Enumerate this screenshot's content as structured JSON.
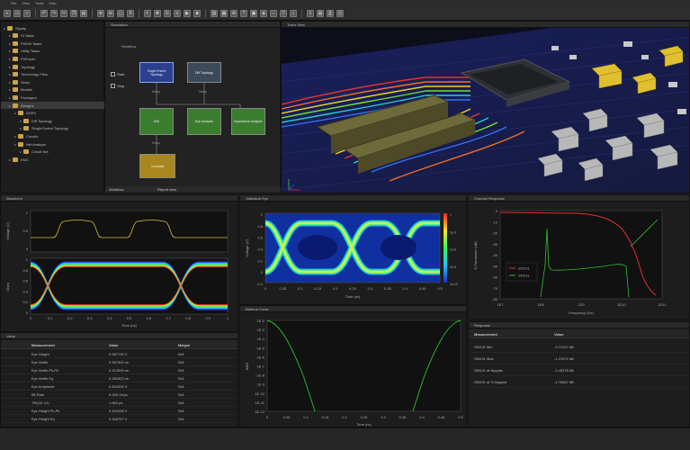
{
  "menu": [
    "File",
    "View",
    "Tools",
    "Help"
  ],
  "left_panel": {
    "title": "",
    "items": [
      {
        "label": "Signity",
        "depth": 0
      },
      {
        "label": "SI Tasks",
        "depth": 1
      },
      {
        "label": "PI/EMI Tasks",
        "depth": 1
      },
      {
        "label": "Utility Tasks",
        "depth": 1
      },
      {
        "label": "PI/Power",
        "depth": 1
      },
      {
        "label": "Topology",
        "depth": 1
      },
      {
        "label": "Technology Files",
        "depth": 1
      },
      {
        "label": "Setup",
        "depth": 1
      },
      {
        "label": "Models",
        "depth": 1
      },
      {
        "label": "Packages",
        "depth": 1
      },
      {
        "label": "Designs",
        "depth": 1,
        "selected": true
      },
      {
        "label": "DDR4",
        "depth": 2
      },
      {
        "label": "Diff Topology",
        "depth": 3
      },
      {
        "label": "Single Ended Topology",
        "depth": 3
      },
      {
        "label": "Circuits",
        "depth": 2
      },
      {
        "label": "Net Analysis",
        "depth": 2
      },
      {
        "label": "Circuit Net",
        "depth": 3
      },
      {
        "label": "EMC",
        "depth": 1
      }
    ]
  },
  "flow_panel": {
    "title": "Simulation",
    "subtitle": "Workflow",
    "start_label": "Start",
    "stop_label": "Stop",
    "nodes": [
      {
        "id": "single",
        "label": "Single Ended Topology",
        "color": "#2b3f8f"
      },
      {
        "id": "diff",
        "label": "Diff Topology",
        "color": "#3b4a5a"
      },
      {
        "id": "sim",
        "label": "SIM",
        "color": "#3a7d2e"
      },
      {
        "id": "eye",
        "label": "Eye Analysis",
        "color": "#3a7d2e"
      },
      {
        "id": "imp",
        "label": "Impedance Analysis",
        "color": "#3a7d2e"
      },
      {
        "id": "cross",
        "label": "Crosstalk",
        "color": "#a8871e"
      }
    ],
    "edge_labels": [
      "Setup",
      "Setup",
      "Setup"
    ],
    "footer_left": "Workflow",
    "footer_right": "Report view"
  },
  "view3d": {
    "title": "Trace View"
  },
  "waveform": {
    "title": "Waveform",
    "ylabel_top": "Voltage (V)",
    "ylabel_bottom": "Gbps",
    "xlabel": "Time (ns)",
    "xticks": [
      "0",
      "0.1",
      "0.2",
      "0.3",
      "0.4",
      "0.5",
      "0.6",
      "0.7",
      "0.8",
      "0.9",
      "1"
    ],
    "yticks_top": [
      "1",
      "0.5",
      "0"
    ],
    "yticks_bottom": [
      "1",
      "0.8",
      "0.6",
      "0.4",
      "0.2",
      "0"
    ]
  },
  "stat_eye": {
    "title": "Statistical Eye",
    "ylabel": "Voltage (V)",
    "xlabel": "Time (ns)",
    "xticks": [
      "0",
      "0.05",
      "0.1",
      "0.15",
      "0.2",
      "0.25",
      "0.3",
      "0.35",
      "0.4",
      "0.45",
      "0.5"
    ],
    "yticks": [
      "1",
      "0.8",
      "0.6",
      "0.4",
      "0.2",
      "0",
      "-0.2"
    ],
    "colorbar": [
      "1",
      "1e-3",
      "1e-6",
      "1e-9",
      "1e-12"
    ]
  },
  "channel": {
    "title": "Channel Response",
    "ylabel": "S-Parameter (dB)",
    "xlabel": "Frequency (Hz)",
    "xticks": [
      "1E7",
      "1E8",
      "1E9",
      "1E10",
      "1E11"
    ],
    "yticks": [
      "0",
      "-10",
      "-20",
      "-30",
      "-40",
      "-50",
      "-60",
      "-70",
      "-80"
    ],
    "legend": [
      {
        "name": "SDD21",
        "color": "#e03030"
      },
      {
        "name": "SDD11",
        "color": "#30c030"
      }
    ]
  },
  "bathtub": {
    "title": "Bathtub Curve",
    "ylabel": "BER",
    "xlabel": "Time (ns)",
    "xticks": [
      "0",
      "0.05",
      "0.1",
      "0.15",
      "0.2",
      "0.25",
      "0.3",
      "0.35",
      "0.4",
      "0.45",
      "0.5"
    ],
    "yticks": [
      "1E-2",
      "1E-3",
      "1E-4",
      "1E-5",
      "1E-6",
      "1E-7",
      "1E-8",
      "1E-9",
      "1E-10",
      "1E-11",
      "1E-12"
    ]
  },
  "eye_table": {
    "title": "Value",
    "columns": [
      "Measurement",
      "Value",
      "Margin"
    ],
    "rows": [
      [
        "Eye Height",
        "0.387735 V",
        "N/A"
      ],
      [
        "Eye Width",
        "0.357600 ns",
        "N/A"
      ],
      [
        "Eye Width Pk-Pk",
        "0.312500 ns",
        "N/A"
      ],
      [
        "Eye Width Eq",
        "0.280303 ns",
        "N/A"
      ],
      [
        "Eye Amplitude",
        "0.804292 V",
        "N/A"
      ],
      [
        "Bit Rate",
        "5.000 Gbps",
        "N/A"
      ],
      [
        "TIE(1E-12)",
        "1.663 ps",
        "N/A"
      ],
      [
        "Eye Height Pk-Pk",
        "0.424298 V",
        "N/A"
      ],
      [
        "Eye Height Eq",
        "0.348707 V",
        "N/A"
      ]
    ]
  },
  "resp_table": {
    "title": "Response",
    "columns": [
      "Measurement",
      "Value"
    ],
    "rows": [
      [
        "SDD21 Min",
        "-3.71227 dB"
      ],
      [
        "SDD21 Max",
        "-1.37672 dB"
      ],
      [
        "SDD21 at Nyquist",
        "-2.45378 dB"
      ],
      [
        "SDD21 at ½ Nyquist",
        "-1.78467 dB"
      ]
    ]
  }
}
